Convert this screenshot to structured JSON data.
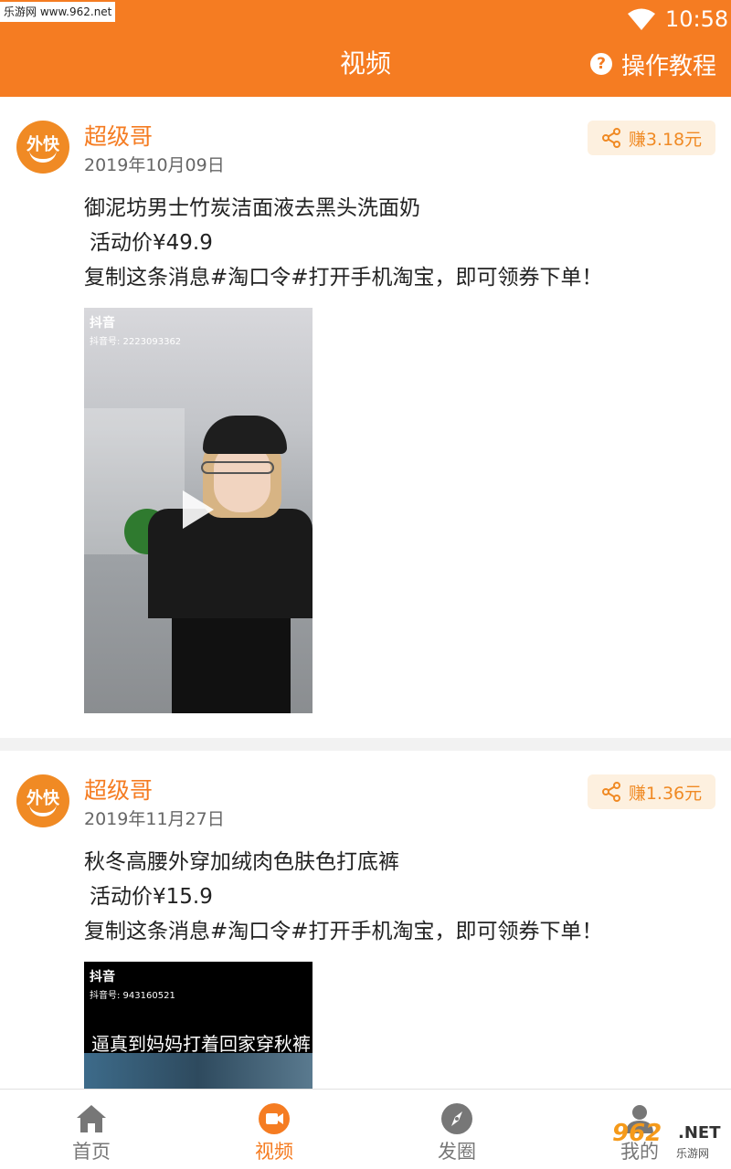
{
  "status_bar": {
    "watermark": "乐游网 www.962.net",
    "time": "10:58"
  },
  "header": {
    "title": "视频",
    "help_label": "操作教程"
  },
  "posts": [
    {
      "username": "超级哥",
      "avatar_text": "外快",
      "date": "2019年10月09日",
      "earn_label": "赚3.18元",
      "lines": [
        "御泥坊男士竹炭洁面液去黑头洗面奶",
        "活动价¥49.9",
        "复制这条消息#淘口令#打开手机淘宝，即可领券下单！"
      ],
      "video": {
        "logo_text": "抖音",
        "account_id": "抖音号: 2223093362"
      }
    },
    {
      "username": "超级哥",
      "avatar_text": "外快",
      "date": "2019年11月27日",
      "earn_label": "赚1.36元",
      "lines": [
        "秋冬高腰外穿加绒肉色肤色打底裤",
        "活动价¥15.9",
        "复制这条消息#淘口令#打开手机淘宝，即可领券下单！"
      ],
      "video": {
        "logo_text": "抖音",
        "account_id": "抖音号: 943160521",
        "caption": "逼真到妈妈打着回家穿秋裤😭"
      }
    }
  ],
  "tabbar": {
    "items": [
      {
        "label": "首页",
        "icon": "home-icon",
        "active": false
      },
      {
        "label": "视频",
        "icon": "video-icon",
        "active": true
      },
      {
        "label": "发圈",
        "icon": "compass-icon",
        "active": false
      },
      {
        "label": "我的",
        "icon": "person-icon",
        "active": false
      }
    ]
  },
  "watermark": {
    "brand": "962",
    "suffix": ".NET",
    "cn": "乐游网"
  },
  "colors": {
    "accent": "#f57c22",
    "earn_bg": "#fdf0df",
    "inactive": "#777777"
  }
}
